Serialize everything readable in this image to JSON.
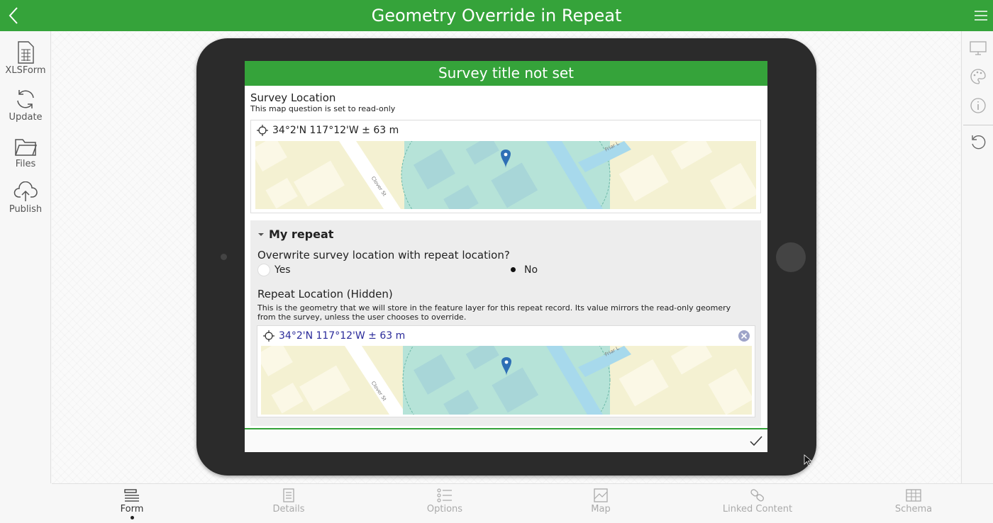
{
  "header": {
    "title": "Geometry Override in Repeat",
    "back_icon": "chevron-left-icon",
    "menu_icon": "hamburger-menu-icon",
    "color": "#35a33a"
  },
  "left_toolbar": {
    "items": [
      {
        "label": "XLSForm",
        "icon": "spreadsheet-icon"
      },
      {
        "label": "Update",
        "icon": "refresh-icon"
      },
      {
        "label": "Files",
        "icon": "folder-icon"
      },
      {
        "label": "Publish",
        "icon": "cloud-upload-icon"
      }
    ]
  },
  "right_toolbar": {
    "items": [
      {
        "icon": "monitor-icon"
      },
      {
        "icon": "palette-icon"
      },
      {
        "icon": "info-icon"
      },
      {
        "icon": "reload-icon"
      }
    ]
  },
  "survey": {
    "title": "Survey title not set",
    "location_question": {
      "label": "Survey Location",
      "hint": "This map question is set to read-only",
      "value": "34°2'N 117°12'W ± 63 m",
      "street_label": "Clover St",
      "street_label_2": "Friar L"
    },
    "repeat": {
      "title": "My repeat",
      "override_question": {
        "label": "Overwrite survey location with repeat location?",
        "options": [
          "Yes",
          "No"
        ],
        "selected": "No"
      },
      "repeat_location": {
        "label": "Repeat Location (Hidden)",
        "hint": "This is the geometry that we will store in the feature layer for this repeat record. Its value mirrors the read-only geomery from the survey, unless the user chooses to override.",
        "value": "34°2'N 117°12'W ± 63 m",
        "value_color": "#2a2a9a"
      }
    }
  },
  "bottom_tabs": {
    "items": [
      {
        "label": "Form",
        "icon": "form-icon",
        "active": true
      },
      {
        "label": "Details",
        "icon": "details-icon",
        "active": false
      },
      {
        "label": "Options",
        "icon": "options-list-icon",
        "active": false
      },
      {
        "label": "Map",
        "icon": "map-icon",
        "active": false
      },
      {
        "label": "Linked Content",
        "icon": "link-icon",
        "active": false
      },
      {
        "label": "Schema",
        "icon": "table-icon",
        "active": false
      }
    ]
  }
}
